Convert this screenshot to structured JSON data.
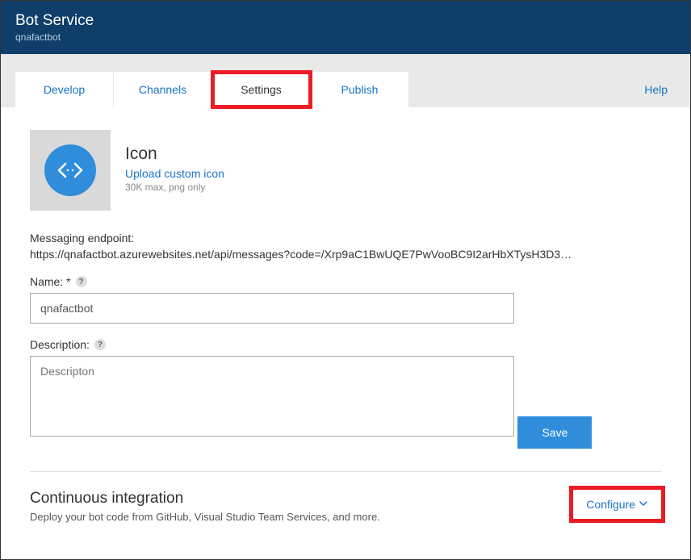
{
  "header": {
    "title": "Bot Service",
    "subtitle": "qnafactbot"
  },
  "tabs": {
    "develop": "Develop",
    "channels": "Channels",
    "settings": "Settings",
    "publish": "Publish"
  },
  "help_label": "Help",
  "icon_section": {
    "title": "Icon",
    "upload_link": "Upload custom icon",
    "hint": "30K max, png only"
  },
  "endpoint": {
    "label": "Messaging endpoint:",
    "value": "https://qnafactbot.azurewebsites.net/api/messages?code=/Xrp9aC1BwUQE7PwVooBC9I2arHbXTysH3D3…"
  },
  "name_field": {
    "label": "Name: *",
    "value": "qnafactbot"
  },
  "description_field": {
    "label": "Description:",
    "placeholder": "Descripton"
  },
  "save_label": "Save",
  "ci": {
    "title": "Continuous integration",
    "desc": "Deploy your bot code from GitHub, Visual Studio Team Services, and more.",
    "configure_label": "Configure"
  }
}
